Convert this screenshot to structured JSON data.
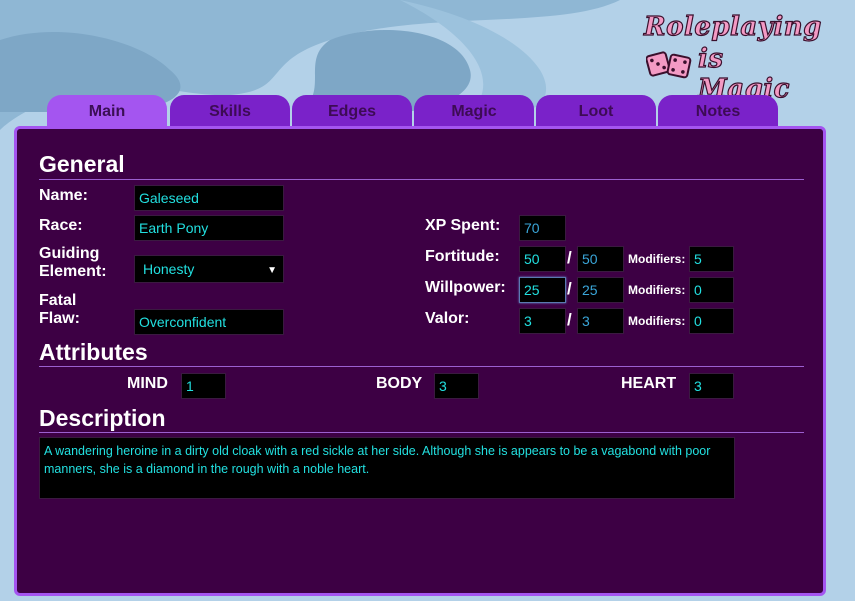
{
  "logo": {
    "line1": "Roleplaying",
    "line2": "is Magic"
  },
  "tabs": [
    {
      "label": "Main",
      "active": true
    },
    {
      "label": "Skills",
      "active": false
    },
    {
      "label": "Edges",
      "active": false
    },
    {
      "label": "Magic",
      "active": false
    },
    {
      "label": "Loot",
      "active": false
    },
    {
      "label": "Notes",
      "active": false
    }
  ],
  "general": {
    "title": "General",
    "name_label": "Name:",
    "name_value": "Galeseed",
    "race_label": "Race:",
    "race_value": "Earth Pony",
    "guiding_label": "Guiding Element:",
    "guiding_value": "Honesty",
    "fatal_label": "Fatal Flaw:",
    "fatal_value": "Overconfident",
    "xp_label": "XP Spent:",
    "xp_value": "70",
    "fortitude_label": "Fortitude:",
    "fortitude_current": "50",
    "fortitude_max": "50",
    "fortitude_mod": "5",
    "willpower_label": "Willpower:",
    "willpower_current": "25",
    "willpower_max": "25",
    "willpower_mod": "0",
    "valor_label": "Valor:",
    "valor_current": "3",
    "valor_max": "3",
    "valor_mod": "0",
    "modifiers_label": "Modifiers:",
    "slash": "/"
  },
  "attributes": {
    "title": "Attributes",
    "mind_label": "MIND",
    "mind_value": "1",
    "body_label": "BODY",
    "body_value": "3",
    "heart_label": "HEART",
    "heart_value": "3"
  },
  "description": {
    "title": "Description",
    "text": "A wandering heroine in a dirty old cloak with a red sickle at her side. Although she is appears to be a vagabond with poor manners, she is a diamond in the rough with a noble heart."
  },
  "colors": {
    "panel_bg": "#3d0044",
    "tab": "#7a22c9",
    "tab_active": "#a455f0",
    "field_text": "#22e0e0",
    "logo_pink": "#f39ac4"
  }
}
